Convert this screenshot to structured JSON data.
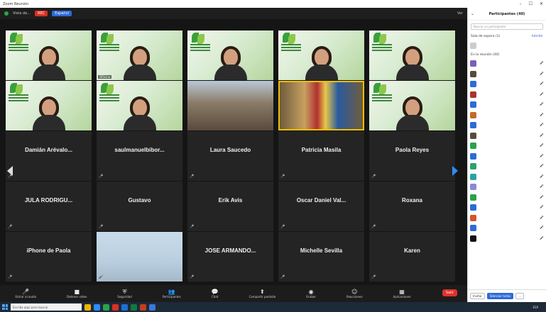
{
  "window": {
    "title": "Zoom Reunión",
    "minimize": "–",
    "maximize": "☐",
    "close": "✕"
  },
  "topbar": {
    "meeting_label": "Vista de…",
    "rec_label": "REC",
    "language_label": "Español",
    "view_label": "Ver"
  },
  "video_tiles": [
    {
      "label": ""
    },
    {
      "label": "Ofiicina"
    },
    {
      "label": ""
    },
    {
      "label": ""
    },
    {
      "label": ""
    },
    {
      "label": ""
    },
    {
      "label": ""
    },
    {
      "label": ""
    },
    {
      "label": ""
    },
    {
      "label": ""
    }
  ],
  "name_tiles": [
    {
      "name": "Damián Arévalo...",
      "sub": ""
    },
    {
      "name": "saulmanuelbibor...",
      "sub": ""
    },
    {
      "name": "Laura Saucedo",
      "sub": ""
    },
    {
      "name": "Patricia Masila",
      "sub": ""
    },
    {
      "name": "Paola Reyes",
      "sub": ""
    },
    {
      "name": "JULA RODRIGU...",
      "sub": ""
    },
    {
      "name": "Gustavo",
      "sub": ""
    },
    {
      "name": "Erik Avis",
      "sub": ""
    },
    {
      "name": "Oscar Daniel Val...",
      "sub": ""
    },
    {
      "name": "Roxana",
      "sub": ""
    },
    {
      "name": "iPhone de Paola",
      "sub": ""
    },
    {
      "name": "",
      "sub": ""
    },
    {
      "name": "JOSE ARMANDO...",
      "sub": ""
    },
    {
      "name": "Michelle Sevilla",
      "sub": ""
    },
    {
      "name": "Karen",
      "sub": ""
    }
  ],
  "controls": [
    {
      "label": "Entrar al audio",
      "icon": "mic-icon"
    },
    {
      "label": "Detener video",
      "icon": "video-icon"
    },
    {
      "label": "Seguridad",
      "icon": "shield-icon"
    },
    {
      "label": "Participantes",
      "icon": "people-icon"
    },
    {
      "label": "Chat",
      "icon": "chat-icon"
    },
    {
      "label": "Compartir pantalla",
      "icon": "share-icon"
    },
    {
      "label": "Grabar",
      "icon": "record-icon"
    },
    {
      "label": "Reacciones",
      "icon": "reaction-icon"
    },
    {
      "label": "Aplicaciones",
      "icon": "apps-icon"
    }
  ],
  "end_label": "Salir",
  "panel": {
    "title": "Participantes (40)",
    "search_placeholder": "Buscar un participante",
    "waiting_header": "Sala de espera (1)",
    "admit_label": "Admitir",
    "waiting_person": "",
    "in_meeting_header": "En la reunión (40)",
    "participants": [
      {
        "name": "",
        "initials": "",
        "color": "#7b5fb8"
      },
      {
        "name": "",
        "initials": "",
        "color": "#5a4a3e"
      },
      {
        "name": "",
        "initials": "",
        "color": "#2d6bd6"
      },
      {
        "name": "",
        "initials": "",
        "color": "#a33"
      },
      {
        "name": "",
        "initials": "",
        "color": "#2d6bd6"
      },
      {
        "name": "",
        "initials": "",
        "color": "#c46a2a"
      },
      {
        "name": "",
        "initials": "",
        "color": "#2d6bd6"
      },
      {
        "name": "",
        "initials": "",
        "color": "#5a4a3e"
      },
      {
        "name": "",
        "initials": "",
        "color": "#2aa34a"
      },
      {
        "name": "",
        "initials": "",
        "color": "#2d6bd6"
      },
      {
        "name": "",
        "initials": "",
        "color": "#2aa36a"
      },
      {
        "name": "",
        "initials": "",
        "color": "#2aa3a3"
      },
      {
        "name": "",
        "initials": "",
        "color": "#8a8ad6"
      },
      {
        "name": "",
        "initials": "",
        "color": "#2aa34a"
      },
      {
        "name": "",
        "initials": "",
        "color": "#2d6bd6"
      },
      {
        "name": "",
        "initials": "",
        "color": "#d6532d"
      },
      {
        "name": "",
        "initials": "",
        "color": "#2d6bd6"
      },
      {
        "name": "",
        "initials": "",
        "color": "#111111"
      }
    ],
    "footer_invite": "Invitar",
    "footer_mute_all": "Silenciar todos",
    "footer_more": "..."
  },
  "taskbar": {
    "search_placeholder": "Escriba aquí para buscar",
    "tray_text": "ESP",
    "time": "",
    "date": ""
  }
}
